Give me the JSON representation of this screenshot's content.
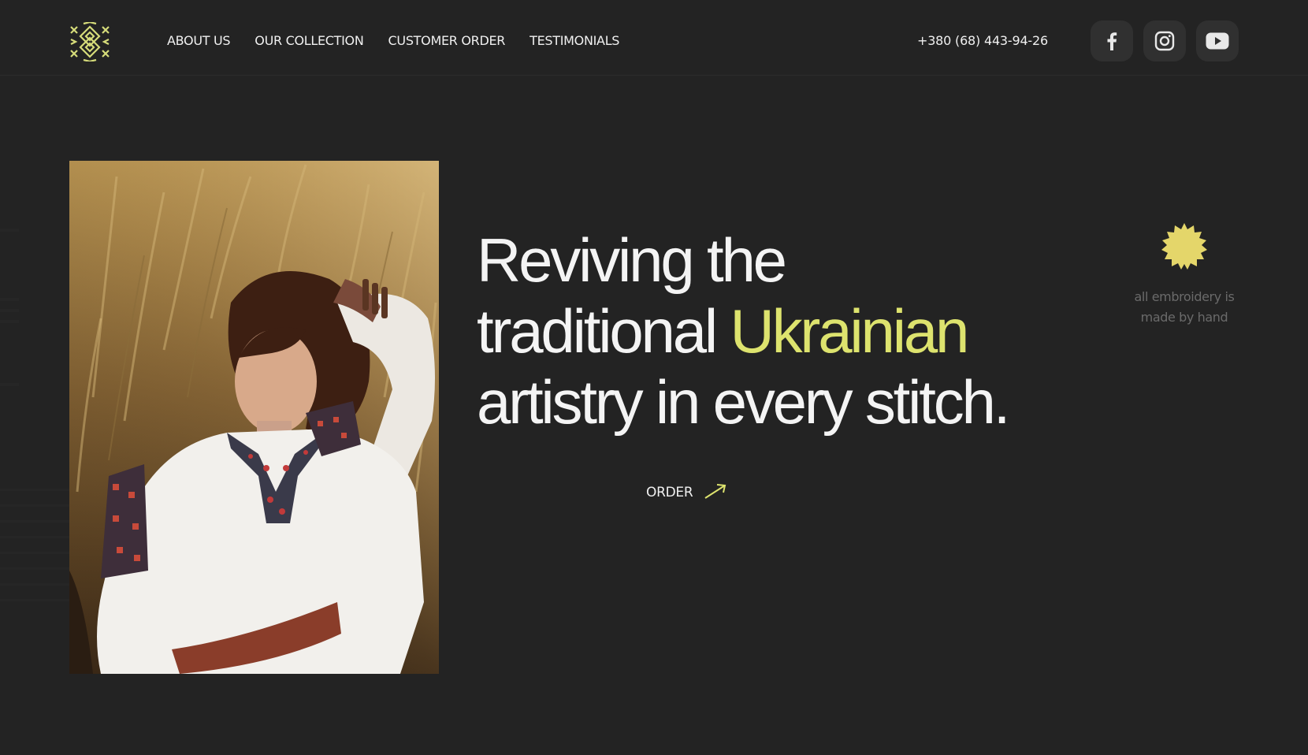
{
  "colors": {
    "background": "#232323",
    "accent": "#dde36e",
    "text": "#f4f4f4",
    "muted": "#6a6a6a"
  },
  "header": {
    "logo_icon": "embroidery-pattern-logo",
    "nav": [
      {
        "label": "ABOUT US"
      },
      {
        "label": "OUR COLLECTION"
      },
      {
        "label": "CUSTOMER ORDER"
      },
      {
        "label": "TESTIMONIALS"
      }
    ],
    "phone": "+380 (68) 443-94-26",
    "socials": [
      {
        "icon": "facebook-icon"
      },
      {
        "icon": "instagram-icon"
      },
      {
        "icon": "youtube-icon"
      }
    ]
  },
  "hero": {
    "headline_line1": "Reviving the",
    "headline_line2_start": "traditional",
    "headline_line2_accent": "Ukrainian",
    "headline_line3": "artistry in every stitch.",
    "order_label": "ORDER",
    "badge_icon": "sun-badge-icon",
    "badge_text_line1": "all embroidery is",
    "badge_text_line2": "made by hand"
  }
}
